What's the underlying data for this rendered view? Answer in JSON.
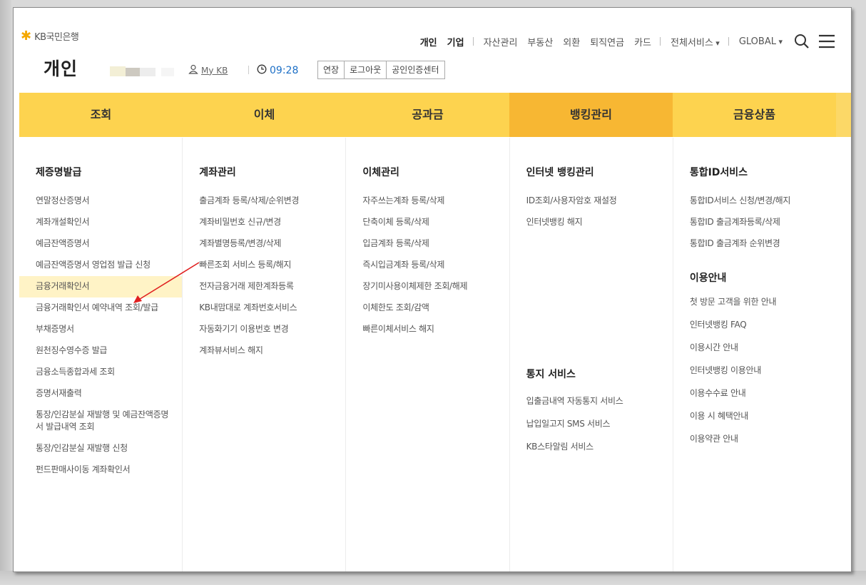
{
  "header": {
    "logo_text": "KB국민은행",
    "section_title": "개인",
    "mykb_label": "My KB",
    "session_time": "09:28",
    "buttons": [
      "연장",
      "로그아웃",
      "공인인증센터"
    ]
  },
  "topnav": {
    "items": [
      "개인",
      "기업",
      "자산관리",
      "부동산",
      "외환",
      "퇴직연금",
      "카드",
      "전체서비스",
      "GLOBAL"
    ]
  },
  "mainnav": {
    "tabs": [
      "조회",
      "이체",
      "공과금",
      "뱅킹관리",
      "금융상품"
    ],
    "active": "뱅킹관리"
  },
  "columns": {
    "c1": {
      "heading": "제증명발급",
      "items": [
        "연말정산증명서",
        "계좌개설확인서",
        "예금잔액증명서",
        "예금잔액증명서 영업점 발급 신청",
        "금융거래확인서",
        "금융거래확인서 예약내역 조회/발급",
        "부채증명서",
        "원천징수영수증 발급",
        "금융소득종합과세 조회",
        "증명서재출력",
        "통장/인감분실 재발행 및 예금잔액증명서 발급내역 조회",
        "통장/인감분실 재발행 신청",
        "펀드판매사이동 계좌확인서"
      ]
    },
    "c2": {
      "heading": "계좌관리",
      "items": [
        "출금계좌 등록/삭제/순위변경",
        "계좌비밀번호 신규/변경",
        "계좌별명등록/변경/삭제",
        "빠른조회 서비스 등록/해지",
        "전자금융거래 제한계좌등록",
        "KB내맘대로 계좌번호서비스",
        "자동화기기 이용번호 변경",
        "계좌뷰서비스 해지"
      ]
    },
    "c3": {
      "heading": "이체관리",
      "items": [
        "자주쓰는계좌 등록/삭제",
        "단축이체 등록/삭제",
        "입금계좌 등록/삭제",
        "즉시입금계좌 등록/삭제",
        "장기미사용이체제한 조회/해제",
        "이체한도 조회/감액",
        "빠른이체서비스 해지"
      ]
    },
    "c4": {
      "heading": "인터넷 뱅킹관리",
      "items": [
        "ID조회/사용자암호 재설정",
        "인터넷뱅킹 해지"
      ],
      "heading2": "통지 서비스",
      "items2": [
        "입출금내역 자동통지 서비스",
        "납입일고지 SMS 서비스",
        "KB스타알림 서비스"
      ]
    },
    "c5": {
      "heading": "통합ID서비스",
      "items": [
        "통합ID서비스 신청/변경/해지",
        "통합ID 출금계좌등록/삭제",
        "통합ID 출금계좌 순위변경"
      ],
      "heading2": "이용안내",
      "items2": [
        "첫 방문 고객을 위한 안내",
        "인터넷뱅킹 FAQ",
        "이용시간 안내",
        "인터넷뱅킹 이용안내",
        "이용수수료 안내",
        "이용 시 혜택안내",
        "이용약관 안내"
      ]
    }
  },
  "colors": {
    "nav_bg": "#fdd34f",
    "nav_active": "#f7b733",
    "highlight": "#fff3c6",
    "arrow": "#e02020",
    "time": "#1c6fc6"
  }
}
